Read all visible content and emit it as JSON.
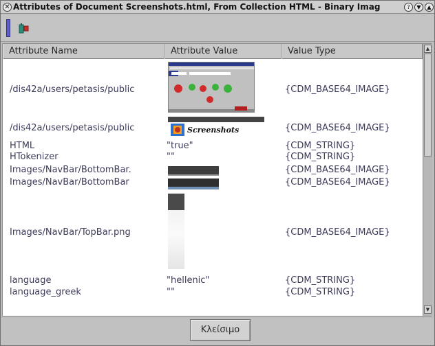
{
  "window": {
    "title": "Attributes of Document Screenshots.html, From Collection HTML - Binary Imag",
    "system_menu_icon": "close-circle-icon",
    "controls": [
      "help-icon",
      "minimize-icon",
      "maximize-icon"
    ]
  },
  "toolbar": {
    "items": [
      "toolbar-grip",
      "attribute-icon"
    ]
  },
  "table": {
    "columns": [
      "Attribute Name",
      "Attribute Value",
      "Value Type"
    ],
    "rows": [
      {
        "name": "/dis42a/users/petasis/public",
        "value": "",
        "value_kind": "image-screenshot",
        "type": "{CDM_BASE64_IMAGE}"
      },
      {
        "name": "/dis42a/users/petasis/public",
        "value": "",
        "value_kind": "image-logo",
        "type": "{CDM_BASE64_IMAGE}"
      },
      {
        "name": "HTML",
        "value": "\"true\"",
        "value_kind": "text",
        "type": "{CDM_STRING}"
      },
      {
        "name": "HTokenizer",
        "value": "\"\"",
        "value_kind": "text",
        "type": "{CDM_STRING}"
      },
      {
        "name": "Images/NavBar/BottomBar.",
        "value": "",
        "value_kind": "image-bar",
        "type": "{CDM_BASE64_IMAGE}"
      },
      {
        "name": "Images/NavBar/BottomBar",
        "value": "",
        "value_kind": "image-bar2",
        "type": "{CDM_BASE64_IMAGE}"
      },
      {
        "name": "Images/NavBar/TopBar.png",
        "value": "",
        "value_kind": "image-topbar",
        "type": "{CDM_BASE64_IMAGE}"
      },
      {
        "name": "language",
        "value": "\"hellenic\"",
        "value_kind": "text",
        "type": "{CDM_STRING}"
      },
      {
        "name": "language_greek",
        "value": "\"\"",
        "value_kind": "text",
        "type": "{CDM_STRING}"
      }
    ],
    "logo_text": "Screenshots"
  },
  "footer": {
    "close_label": "Κλείσιμο"
  },
  "colors": {
    "title_bar": "#cfcfcf",
    "window_bg": "#bdbdbd",
    "text": "#3c3c5a",
    "header_bg": "#c8c8c8"
  }
}
